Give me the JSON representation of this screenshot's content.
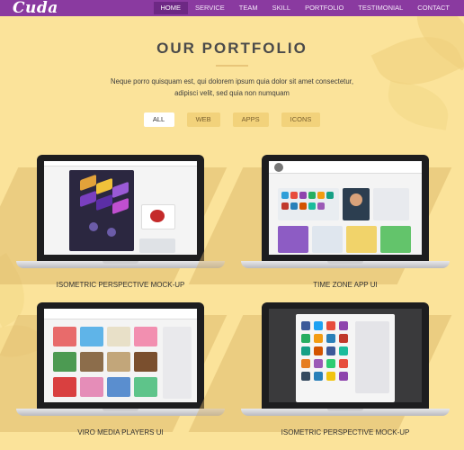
{
  "header": {
    "logo": "Cuda",
    "nav": [
      {
        "label": "HOME",
        "active": true
      },
      {
        "label": "SERVICE",
        "active": false
      },
      {
        "label": "TEAM",
        "active": false
      },
      {
        "label": "SKILL",
        "active": false
      },
      {
        "label": "PORTFOLIO",
        "active": false
      },
      {
        "label": "TESTIMONIAL",
        "active": false
      },
      {
        "label": "CONTACT",
        "active": false
      }
    ],
    "bar_color": "#8a3aa0"
  },
  "section": {
    "title": "OUR PORTFOLIO",
    "description": "Neque porro quisquam est, qui dolorem ipsum quia dolor sit amet consectetur, adipisci velit, sed quia non numquam"
  },
  "filters": [
    {
      "label": "ALL",
      "active": true
    },
    {
      "label": "WEB",
      "active": false
    },
    {
      "label": "APPS",
      "active": false
    },
    {
      "label": "ICONS",
      "active": false
    }
  ],
  "portfolio": [
    {
      "label": "ISOMETRIC PERSPECTIVE MOCK-UP",
      "icon": "laptop-mockup-icon"
    },
    {
      "label": "TIME ZONE APP UI",
      "icon": "laptop-mockup-icon"
    },
    {
      "label": "VIRO MEDIA PLAYERS UI",
      "icon": "laptop-mockup-icon"
    },
    {
      "label": "ISOMETRIC PERSPECTIVE MOCK-UP",
      "icon": "laptop-mockup-icon"
    }
  ],
  "colors": {
    "background": "#fbe39a",
    "accent": "#8a3aa0",
    "filter": "#f2d27b"
  }
}
